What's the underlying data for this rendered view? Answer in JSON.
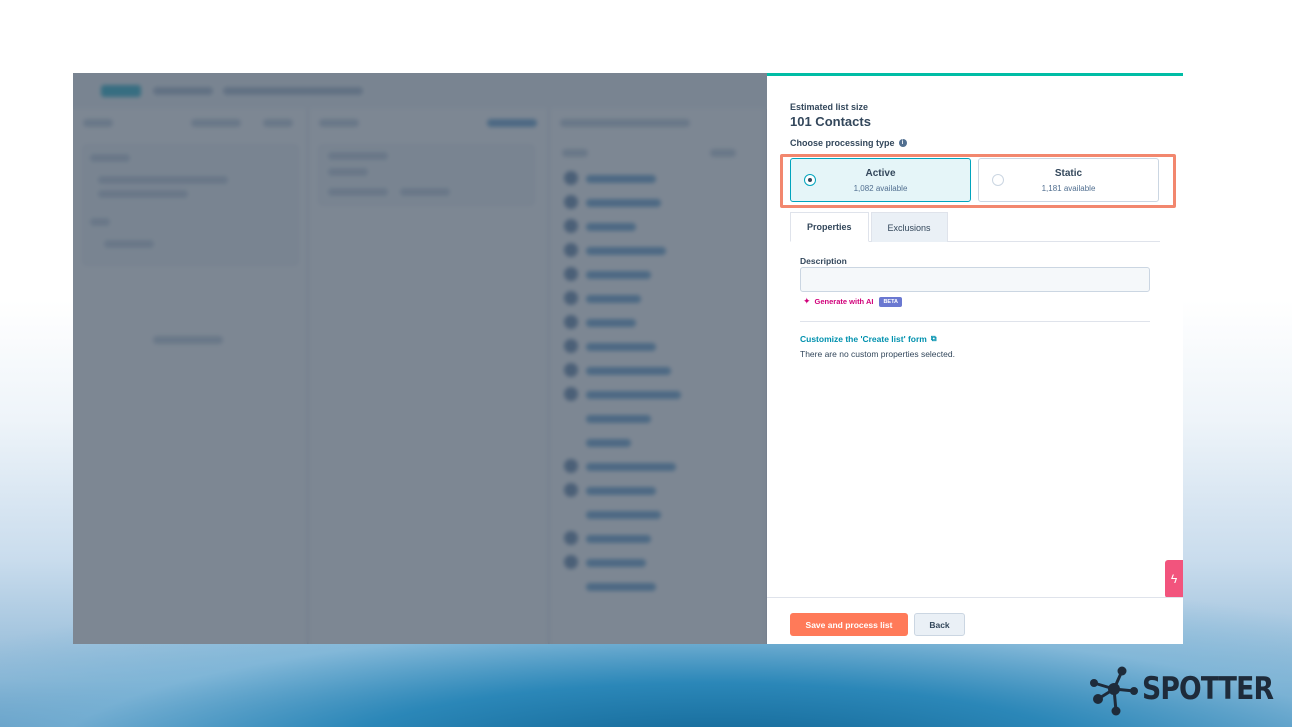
{
  "panel": {
    "estimated_label": "Estimated list size",
    "estimated_value": "101 Contacts",
    "processing_label": "Choose processing type",
    "options": [
      {
        "title": "Active",
        "subtitle": "1,082 available",
        "selected": true
      },
      {
        "title": "Static",
        "subtitle": "1,181 available",
        "selected": false
      }
    ],
    "tabs": [
      {
        "label": "Properties",
        "selected": true
      },
      {
        "label": "Exclusions",
        "selected": false
      }
    ],
    "description_label": "Description",
    "description_value": "",
    "generate_ai_label": "Generate with AI",
    "beta_badge": "BETA",
    "customize_link": "Customize the 'Create list' form",
    "custom_note": "There are no custom properties selected.",
    "save_button": "Save and process list",
    "back_button": "Back"
  },
  "brand": {
    "logo_text": "SPOTTER"
  },
  "colors": {
    "accent_orange": "#ff7a59",
    "highlight": "#f2876e",
    "teal": "#00a4bd",
    "link": "#0091ae",
    "ai_pink": "#d1007a",
    "beta_purple": "#6a78d1"
  },
  "icons": {
    "info": "info-icon",
    "sparkle": "sparkle-icon",
    "external_link": "external-link-icon",
    "flash": "lightning-icon"
  }
}
